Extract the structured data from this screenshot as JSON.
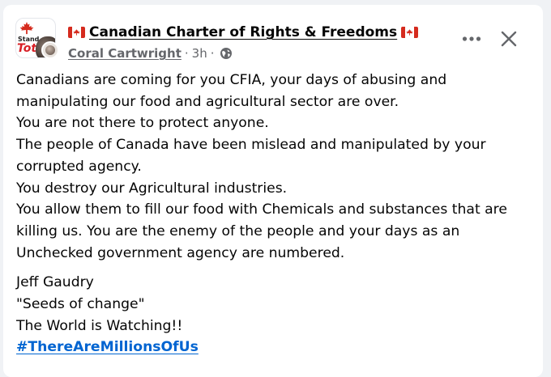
{
  "post": {
    "group_name": "Canadian Charter of Rights & Freedoms",
    "group_flag_icon": "canada-flag",
    "author": "Coral Cartwright",
    "separator": "·",
    "time_ago": "3h",
    "audience_icon": "globe-icon",
    "avatar_text_top": "Stand",
    "avatar_text_bottom": "Toto",
    "body_lines": [
      "Canadians are coming for you CFIA, your days of abusing and manipulating our food and agricultural sector are over.",
      "You are not there to protect anyone.",
      "The people of Canada have been mislead and manipulated by your corrupted agency.",
      "You destroy our Agricultural industries.",
      "You allow them to fill our food with Chemicals and substances that are killing us. You are the enemy of the people and your days as an Unchecked government agency are numbered."
    ],
    "signature_lines": [
      "Jeff Gaudry",
      "\"Seeds of change\"",
      "The World is Watching!!"
    ],
    "hashtag": "#ThereAreMillionsOfUs"
  },
  "colors": {
    "text": "#050505",
    "secondary_text": "#65676b",
    "link": "#0064d1",
    "flag_red": "#d52b1e",
    "background": "#f0f2f5",
    "card": "#ffffff"
  }
}
